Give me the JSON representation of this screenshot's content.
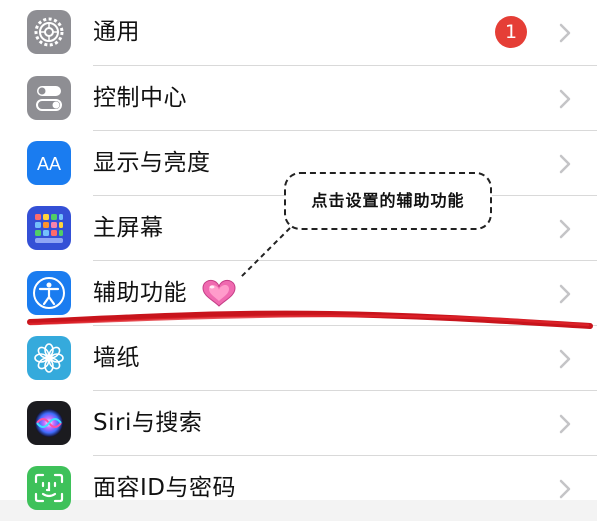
{
  "settings_list": {
    "items": [
      {
        "label": "通用",
        "icon": "gear-icon",
        "color": "#8e8e93",
        "badge": "1"
      },
      {
        "label": "控制中心",
        "icon": "toggle-switches-icon",
        "color": "#8e8e93"
      },
      {
        "label": "显示与亮度",
        "icon": "text-size-aa-icon",
        "color": "#1a7cf0"
      },
      {
        "label": "主屏幕",
        "icon": "app-grid-icon",
        "color": "#3450d6"
      },
      {
        "label": "辅助功能",
        "icon": "accessibility-person-icon",
        "color": "#1a7cf0"
      },
      {
        "label": "墙纸",
        "icon": "flower-icon",
        "color": "#35aadc"
      },
      {
        "label": "Siri与搜索",
        "icon": "siri-orb-icon",
        "color": "#222222"
      },
      {
        "label": "面容ID与密码",
        "icon": "face-id-icon",
        "color": "#3ec15a"
      }
    ]
  },
  "annotation": {
    "callout_text": "点击设置的辅助功能",
    "heart_icon": "heart-emoji-icon",
    "underline_color": "#c8141c"
  }
}
